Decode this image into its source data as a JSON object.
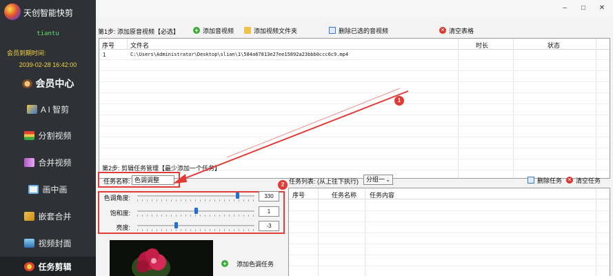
{
  "sidebar": {
    "app_title": "天创智能快剪",
    "username": "tiantu",
    "expire_label": "会员到期时间:",
    "expire_date": "2039-02-28 16:42:00",
    "nav": [
      {
        "label": "会员中心",
        "icon": "member-icon"
      },
      {
        "label": "A I 智剪",
        "icon": "ai-icon"
      },
      {
        "label": "分割视频",
        "icon": "split-icon"
      },
      {
        "label": "合并视频",
        "icon": "merge-icon"
      },
      {
        "label": "画中画",
        "icon": "pip-icon"
      },
      {
        "label": "嵌套合并",
        "icon": "nest-icon"
      },
      {
        "label": "视频封面",
        "icon": "cover-icon"
      },
      {
        "label": "任务剪辑",
        "icon": "task-icon"
      }
    ]
  },
  "window": {
    "minimize": "–",
    "maximize": "□",
    "close": "✕"
  },
  "step1": {
    "label": "第1步: 添加原音视频【必选】",
    "add_video": "添加音视频",
    "add_folder": "添加视频文件夹",
    "remove_selected": "删除已选的音视频",
    "clear_table": "清空表格",
    "columns": [
      "序号",
      "文件名",
      "时长",
      "状态"
    ],
    "rows": [
      {
        "index": "1",
        "filename": "C:\\Users\\Administrator\\Desktop\\slian\\1\\584a67813e27ee15892a23bbb0ccc6c9.mp4",
        "duration": "",
        "status": ""
      }
    ]
  },
  "step2": {
    "label": "第2步: 剪辑任务管理【最少添加一个任务】",
    "task_name_label": "任务名称:",
    "task_name_value": "色调调整",
    "sliders": [
      {
        "label": "色调角度:",
        "value": "330",
        "fraction": 0.85
      },
      {
        "label": "饱和度:",
        "value": "1",
        "fraction": 0.5
      },
      {
        "label": "亮度:",
        "value": "-3",
        "fraction": 0.33
      }
    ],
    "add_task": "添加色调任务",
    "task_list_label": "任务列表: (从上往下执行)",
    "group_value": "分组一",
    "remove_task": "删除任务",
    "clear_task": "清空任务",
    "task_columns": [
      "序号",
      "任务名称",
      "任务内容"
    ]
  },
  "annotations": {
    "badge1": "1",
    "badge2": "2"
  },
  "colors": {
    "sidebar_bg": "#2e3236",
    "accent_red": "#e23a36",
    "slider_thumb": "#1f6fd6",
    "expire_yellow": "#f5d442",
    "username_green": "#5fe06a"
  }
}
